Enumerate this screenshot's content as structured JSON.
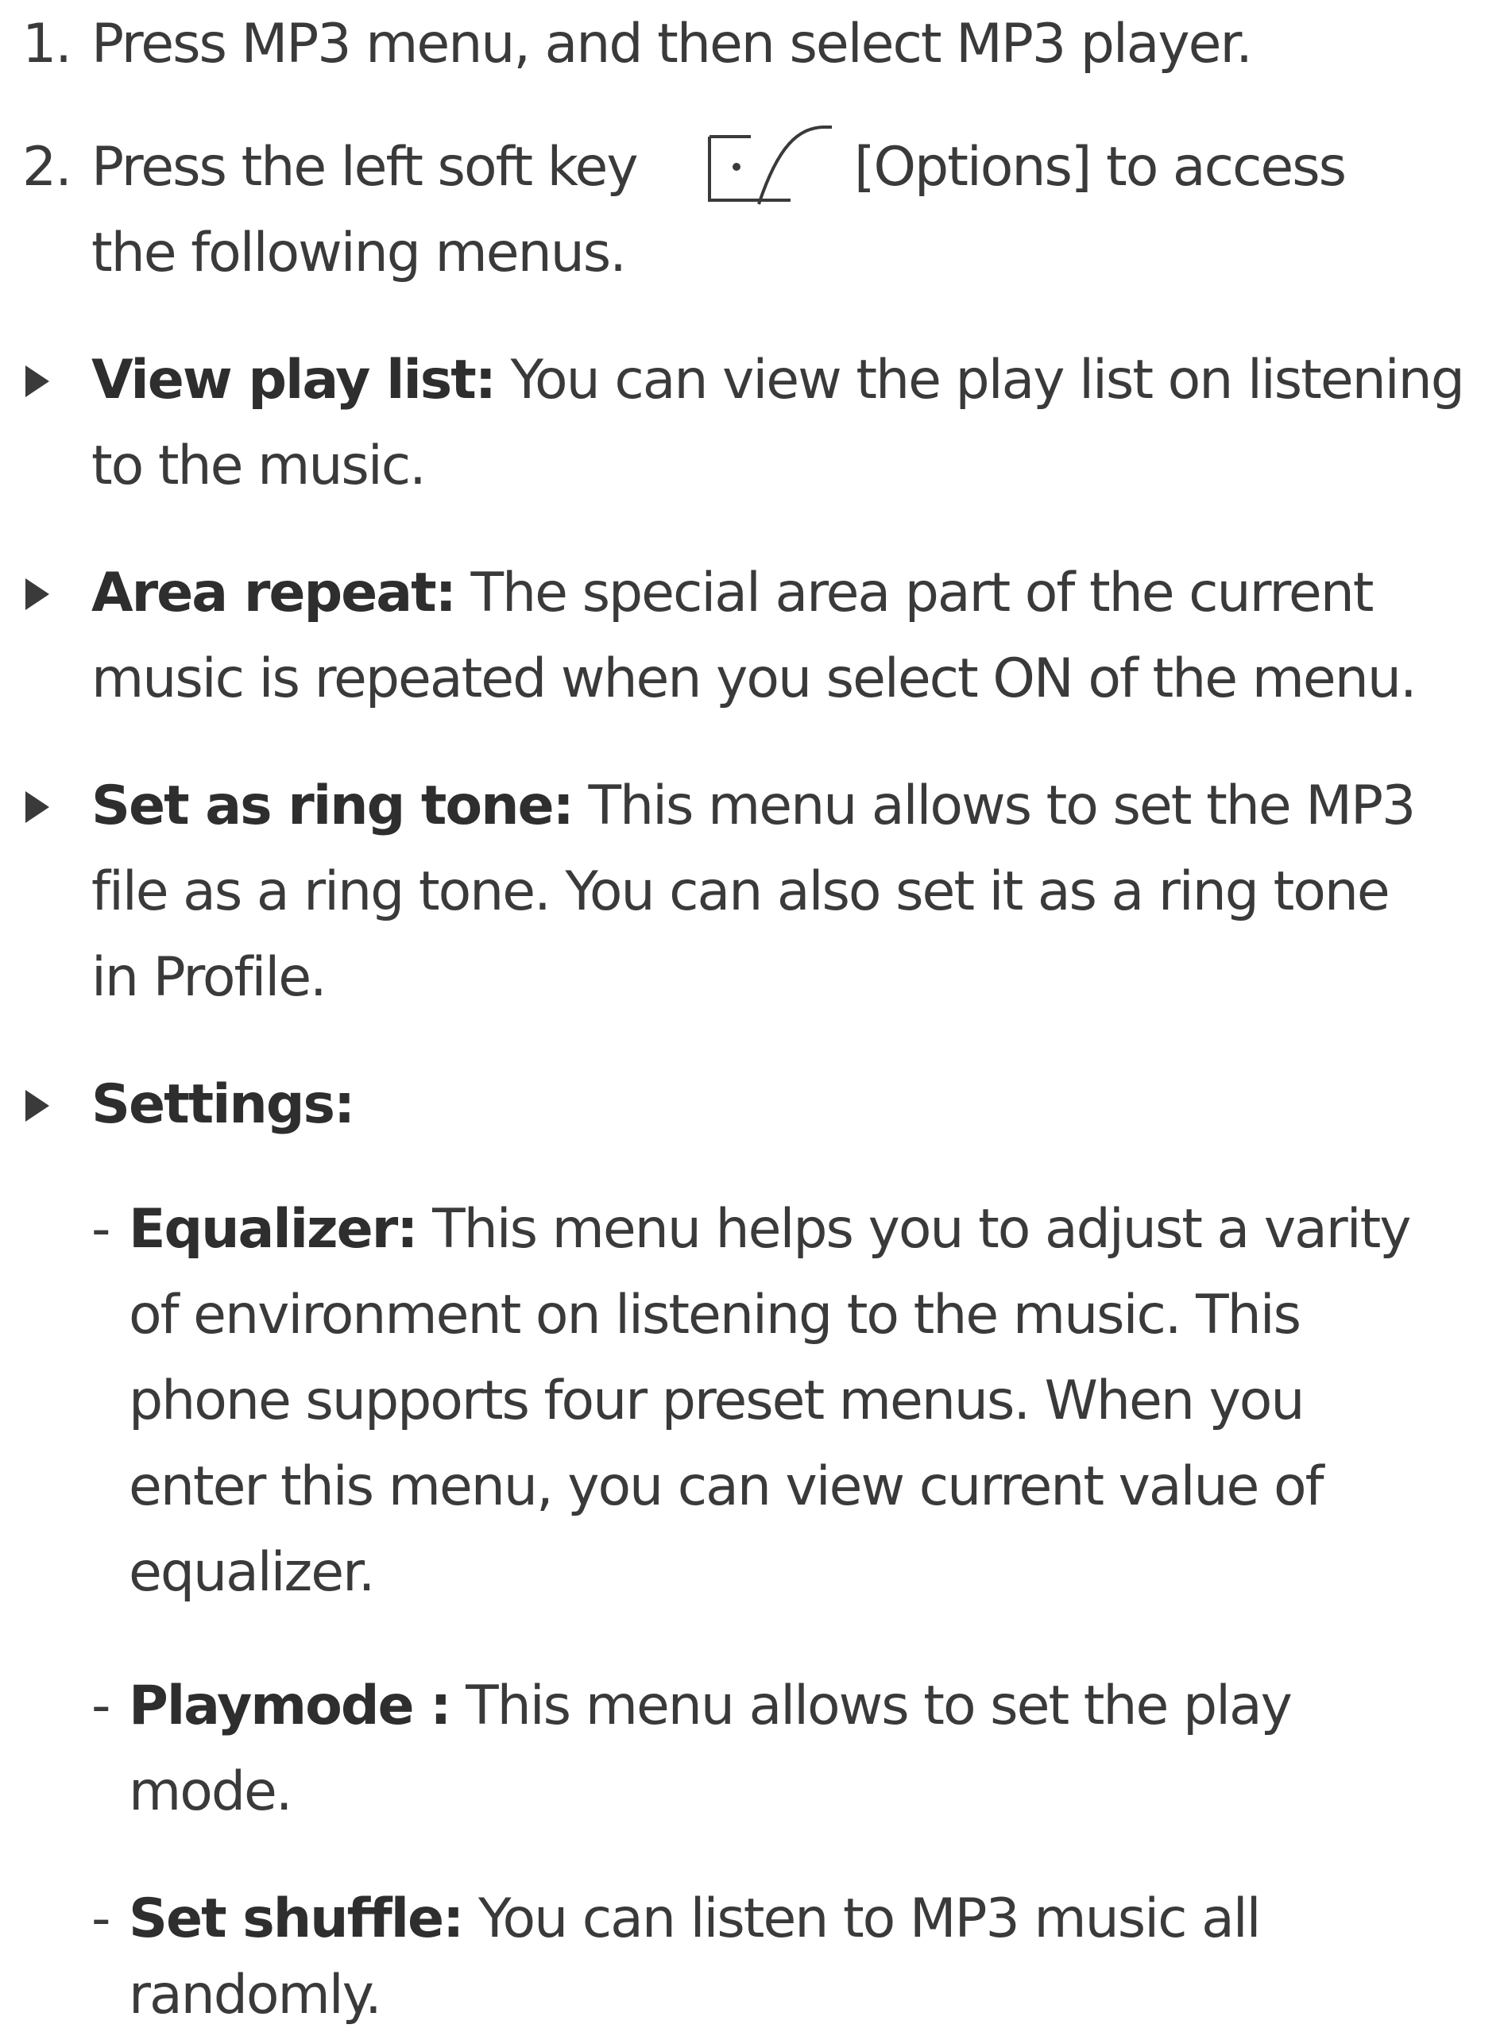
{
  "steps": [
    {
      "number": "1.",
      "lines": [
        "Press MP3 menu, and then select MP3 player."
      ]
    },
    {
      "number": "2.",
      "line1_before": "Press the left soft key",
      "line1_after": "[Options] to access",
      "line2": "the following menus."
    }
  ],
  "icons": {
    "softkey": "left-soft-key-icon",
    "bullet": "triangle-bullet-icon"
  },
  "items": [
    {
      "term": "View play list:",
      "first_rest": " You can view the play list on listening",
      "lines": [
        "to the music."
      ]
    },
    {
      "term": "Area repeat:",
      "first_rest": " The special area part of the current",
      "lines": [
        "music is repeated when you select ON of the menu."
      ]
    },
    {
      "term": "Set as ring tone:",
      "first_rest": " This menu allows to set the MP3",
      "lines": [
        "file as a ring tone. You can also set it as a ring tone",
        "in Profile."
      ]
    },
    {
      "term": "Settings:",
      "first_rest": "",
      "lines": []
    }
  ],
  "subitems": [
    {
      "dash": "-",
      "term": "Equalizer:",
      "first_rest": " This menu helps you to adjust a varity",
      "lines": [
        "of environment on listening to the music. This",
        "phone supports four preset menus. When you",
        "enter this menu, you can view current value of",
        "equalizer."
      ]
    },
    {
      "dash": "-",
      "term": "Playmode :",
      "first_rest": " This menu allows to set the play",
      "lines": [
        "mode."
      ]
    },
    {
      "dash": "-",
      "term": "Set shuffle:",
      "first_rest": " You can listen to MP3 music all",
      "lines": [
        "randomly."
      ]
    }
  ]
}
